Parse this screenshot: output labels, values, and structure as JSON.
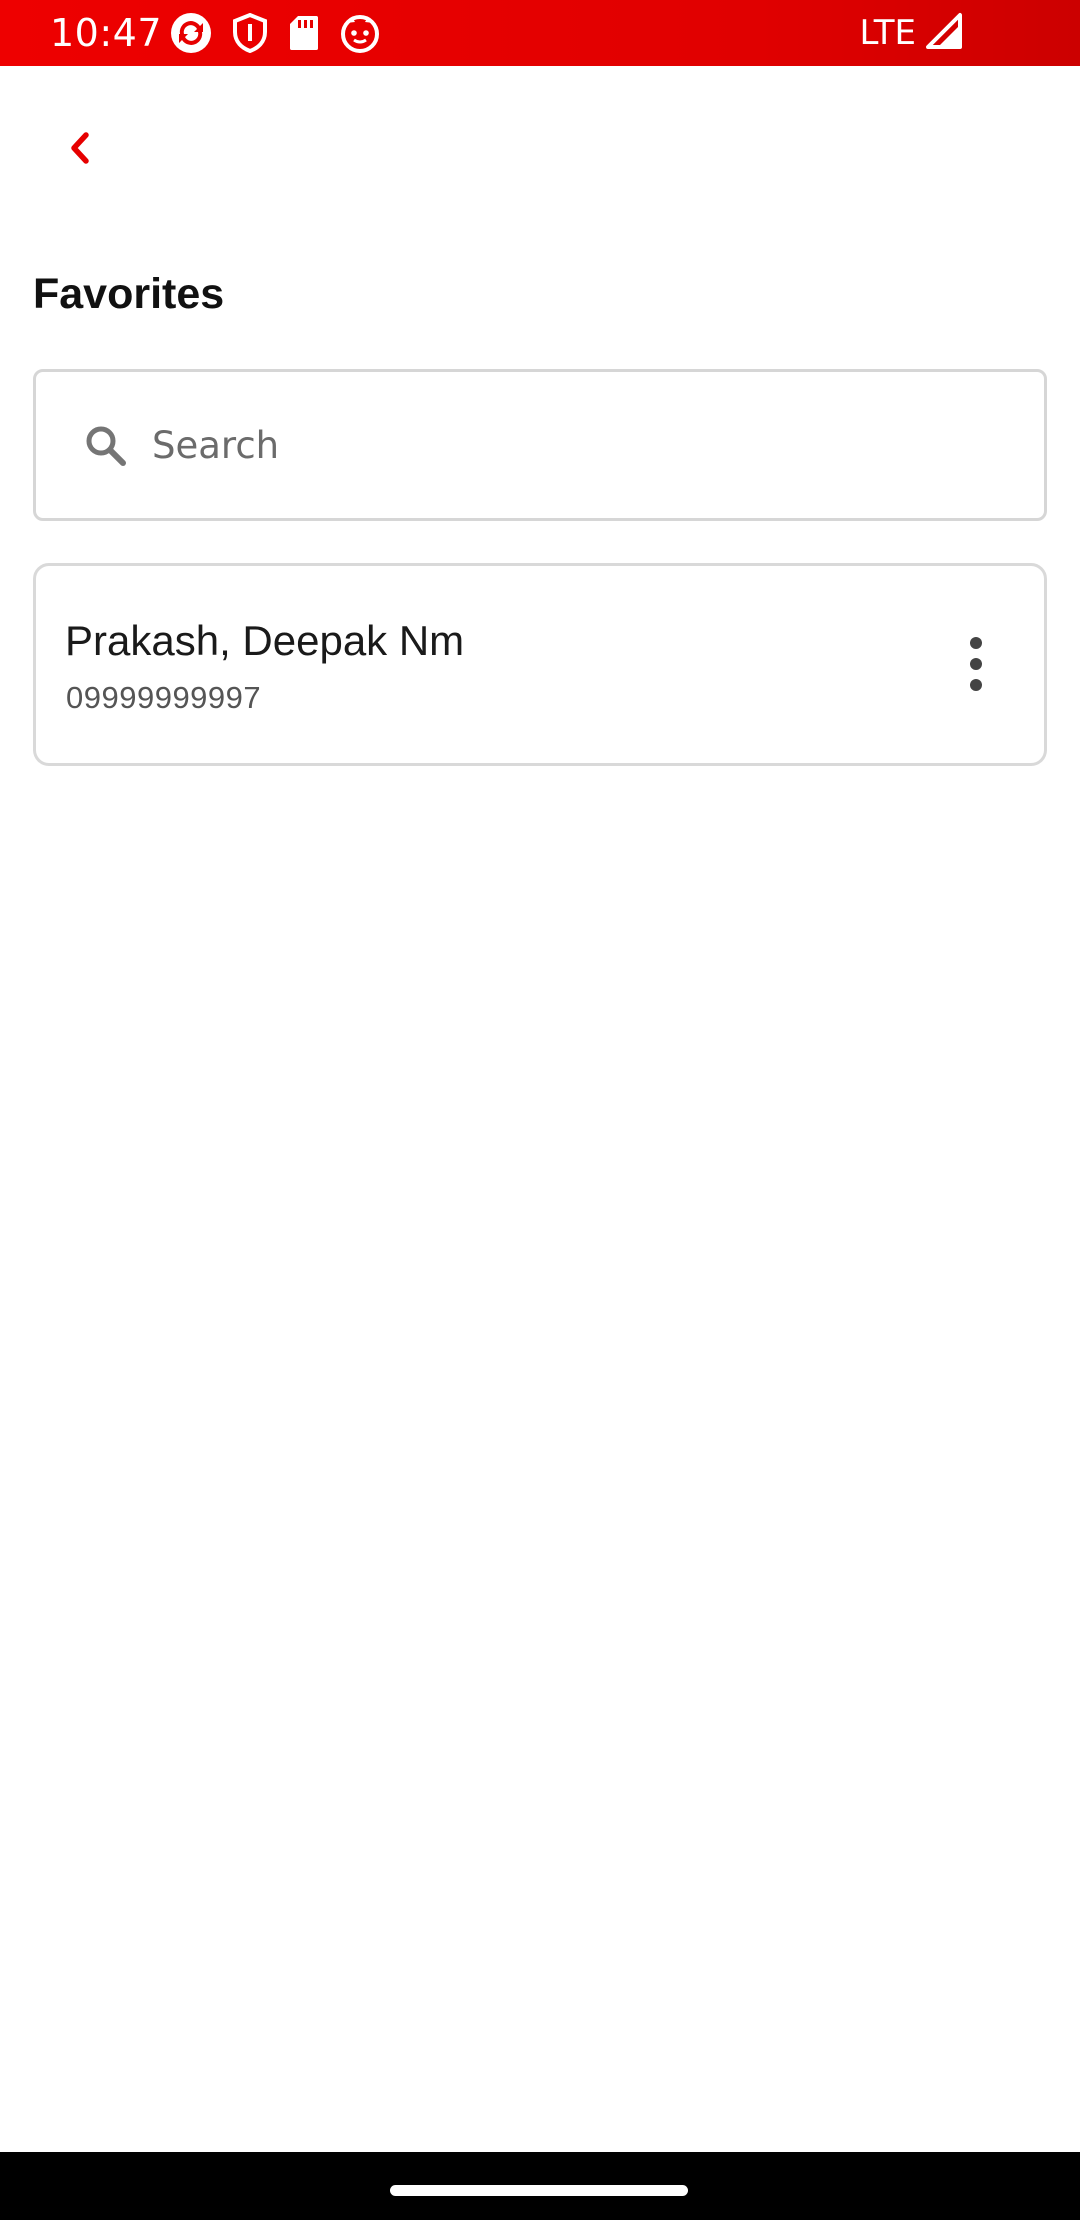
{
  "status_bar": {
    "time": "10:47",
    "network": "LTE",
    "color": "#e60000",
    "left_icons": [
      "sync-app-icon",
      "shield-icon",
      "sd-card-icon",
      "cat-face-icon"
    ],
    "right_icons": [
      "signal-icon"
    ]
  },
  "header": {
    "back_icon": "chevron-left-icon",
    "accent_color": "#e60000"
  },
  "page": {
    "title": "Favorites"
  },
  "search": {
    "placeholder": "Search",
    "value": "",
    "icon": "search-icon"
  },
  "favorites": [
    {
      "name": "Prakash, Deepak Nm",
      "phone": "09999999997",
      "menu_icon": "more-vert-icon"
    }
  ],
  "nav_bar": {
    "indicator": "home-indicator"
  }
}
